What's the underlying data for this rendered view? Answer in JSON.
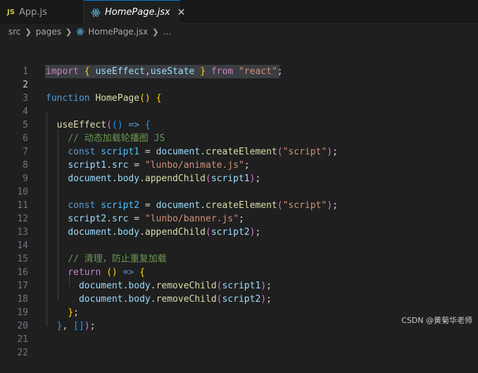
{
  "tabs": [
    {
      "icon_text": "JS",
      "label": "App.js"
    },
    {
      "icon": "react-icon",
      "label": "HomePage.jsx",
      "close": "✕"
    }
  ],
  "breadcrumb": [
    "src",
    "pages",
    "HomePage.jsx",
    "…"
  ],
  "editor": {
    "line_numbers": [
      "1",
      "2",
      "3",
      "4",
      "5",
      "6",
      "7",
      "8",
      "9",
      "10",
      "11",
      "12",
      "13",
      "14",
      "15",
      "16",
      "17",
      "18",
      "19",
      "20",
      "21",
      "22"
    ],
    "active_line": "2",
    "comments": {
      "load_scripts": "// 动态加载轮播图 JS",
      "cleanup": "// 清理，防止重复加载"
    },
    "strings": {
      "react": "\"react\"",
      "script_tag": "\"script\"",
      "animate": "\"lunbo/animate.js\"",
      "banner": "\"lunbo/banner.js\""
    },
    "identifiers": {
      "import": "import",
      "from": "from",
      "useEffect": "useEffect",
      "useState": "useState",
      "function": "function",
      "HomePage": "HomePage",
      "const": "const",
      "script1": "script1",
      "script2": "script2",
      "document": "document",
      "createElement": "createElement",
      "src": "src",
      "body": "body",
      "appendChild": "appendChild",
      "removeChild": "removeChild",
      "return": "return"
    }
  },
  "watermark": "CSDN @黄菊华老师",
  "colors": {
    "background": "#1f1f1f",
    "keyword": "#569cd6",
    "control": "#c586c0",
    "function": "#dcdcaa",
    "variable": "#9cdcfe",
    "string": "#ce9178",
    "comment": "#6a9955"
  }
}
